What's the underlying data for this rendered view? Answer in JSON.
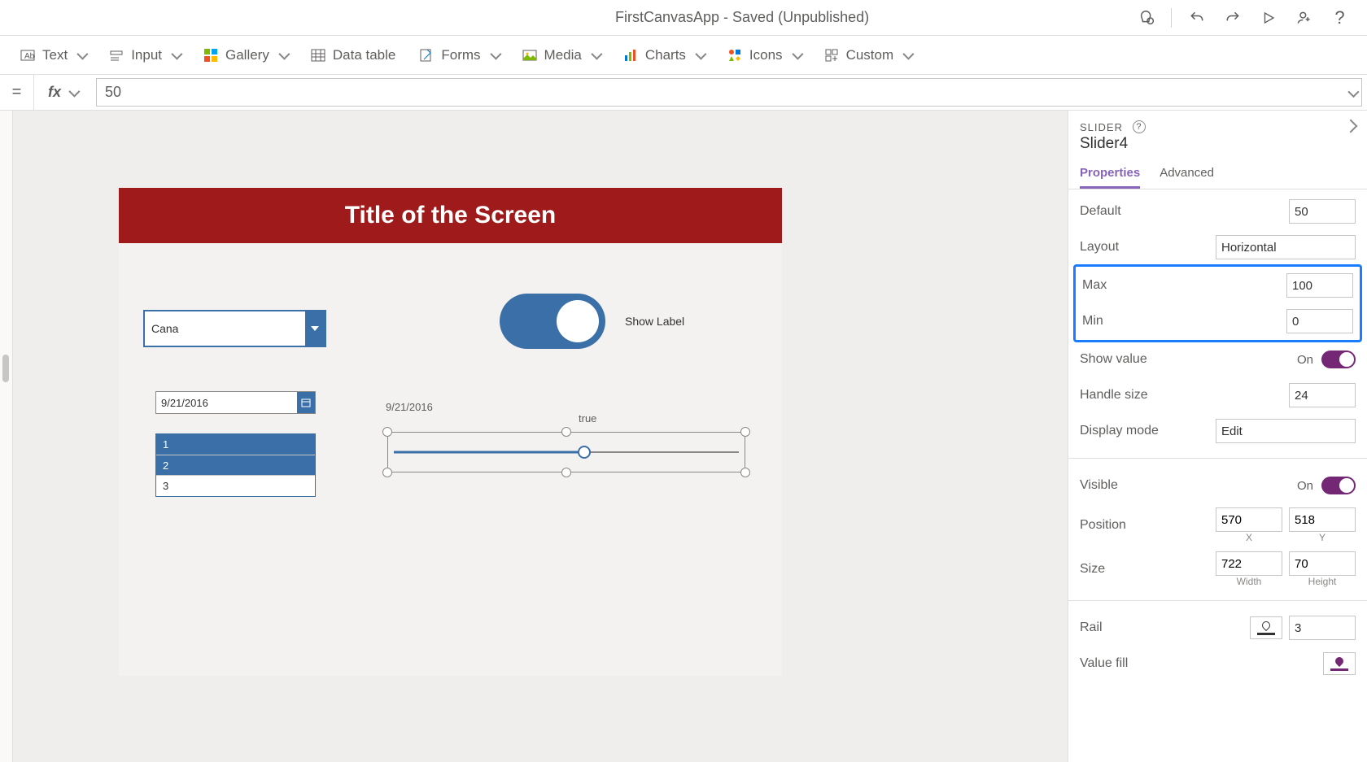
{
  "titlebar": {
    "app_title": "FirstCanvasApp - Saved (Unpublished)"
  },
  "ribbon": {
    "text": "Text",
    "input": "Input",
    "gallery": "Gallery",
    "datatable": "Data table",
    "forms": "Forms",
    "media": "Media",
    "charts": "Charts",
    "icons": "Icons",
    "custom": "Custom"
  },
  "formula": {
    "value": "50"
  },
  "screen": {
    "title": "Title of the Screen",
    "dropdown_value": "Cana",
    "toggle_label": "Show Label",
    "date_value": "9/21/2016",
    "date_echo": "9/21/2016",
    "listbox": [
      "1",
      "2",
      "3"
    ],
    "true_label": "true"
  },
  "props": {
    "type": "SLIDER",
    "name": "Slider4",
    "tabs": {
      "properties": "Properties",
      "advanced": "Advanced"
    },
    "default": {
      "label": "Default",
      "value": "50"
    },
    "layout": {
      "label": "Layout",
      "value": "Horizontal"
    },
    "max": {
      "label": "Max",
      "value": "100"
    },
    "min": {
      "label": "Min",
      "value": "0"
    },
    "showvalue": {
      "label": "Show value",
      "state": "On"
    },
    "handlesize": {
      "label": "Handle size",
      "value": "24"
    },
    "displaymode": {
      "label": "Display mode",
      "value": "Edit"
    },
    "visible": {
      "label": "Visible",
      "state": "On"
    },
    "position": {
      "label": "Position",
      "x": "570",
      "y": "518",
      "xl": "X",
      "yl": "Y"
    },
    "size": {
      "label": "Size",
      "w": "722",
      "h": "70",
      "wl": "Width",
      "hl": "Height"
    },
    "rail": {
      "label": "Rail",
      "value": "3"
    },
    "valuefill": {
      "label": "Value fill"
    }
  }
}
